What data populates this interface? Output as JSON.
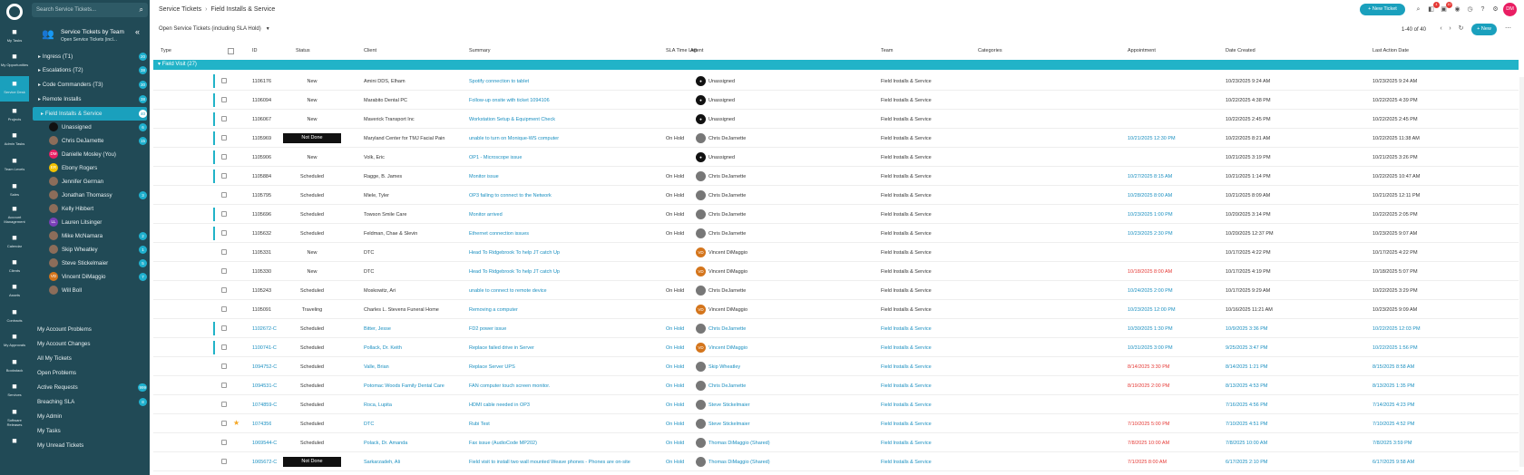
{
  "search": {
    "placeholder": "Search Service Tickets..."
  },
  "rail": [
    {
      "label": "My Tasks",
      "icon": "pencil-icon"
    },
    {
      "label": "My Opportunities",
      "icon": "dollar-icon"
    },
    {
      "label": "Service Desk",
      "icon": "service-desk-icon"
    },
    {
      "label": "Projects",
      "icon": "projects-icon"
    },
    {
      "label": "Admin Tasks",
      "icon": "checkbox-icon"
    },
    {
      "label": "Team Levels",
      "icon": "star-icon"
    },
    {
      "label": "Sales",
      "icon": "chart-icon"
    },
    {
      "label": "Account Management",
      "icon": "people-icon"
    },
    {
      "label": "Calendar",
      "icon": "calendar-icon"
    },
    {
      "label": "Clients",
      "icon": "person-icon"
    },
    {
      "label": "Assets",
      "icon": "asset-icon"
    },
    {
      "label": "Contracts",
      "icon": "contract-icon"
    },
    {
      "label": "My Approvals",
      "icon": "thumb-icon"
    },
    {
      "label": "Bookstack",
      "icon": "book-icon"
    },
    {
      "label": "Services",
      "icon": "services-icon"
    },
    {
      "label": "Software Releases",
      "icon": "release-icon"
    },
    {
      "label": "",
      "icon": "book-icon"
    }
  ],
  "panel": {
    "title": "Service Tickets by Team",
    "subtitle": "Open Service Tickets (incl...",
    "groups": [
      {
        "label": "Ingress (T1)",
        "count": "20"
      },
      {
        "label": "Escalations (T2)",
        "count": "38"
      },
      {
        "label": "Code Commanders (T3)",
        "count": "30"
      },
      {
        "label": "Remote Installs",
        "count": "38"
      },
      {
        "label": "Field Installs & Service",
        "count": "40"
      }
    ],
    "people": [
      {
        "label": "Unassigned",
        "count": "6",
        "av": ""
      },
      {
        "label": "Chris DeJarnette",
        "count": "15",
        "av": ""
      },
      {
        "label": "Danielle Mosley (You)",
        "count": "",
        "av": "DM"
      },
      {
        "label": "Ebony Rogers",
        "count": "",
        "av": "ER"
      },
      {
        "label": "Jennifer German",
        "count": "",
        "av": ""
      },
      {
        "label": "Jonathan Thomassy",
        "count": "3",
        "av": ""
      },
      {
        "label": "Kelly Hibbert",
        "count": "",
        "av": ""
      },
      {
        "label": "Lauren Litsinger",
        "count": "",
        "av": "LL"
      },
      {
        "label": "Mike McNamara",
        "count": "2",
        "av": ""
      },
      {
        "label": "Skip Wheatley",
        "count": "1",
        "av": ""
      },
      {
        "label": "Steve Stickelmaier",
        "count": "5",
        "av": ""
      },
      {
        "label": "Vincent DiMaggio",
        "count": "7",
        "av": "VD"
      },
      {
        "label": "Will Boll",
        "count": "",
        "av": ""
      }
    ],
    "links": [
      {
        "label": "My Account Problems",
        "count": ""
      },
      {
        "label": "My Account Changes",
        "count": ""
      },
      {
        "label": "All My Tickets",
        "count": ""
      },
      {
        "label": "Open Problems",
        "count": ""
      },
      {
        "label": "Active Requests",
        "count": "999"
      },
      {
        "label": "Breaching SLA",
        "count": "8"
      },
      {
        "label": "My Admin",
        "count": ""
      },
      {
        "label": "My Tasks",
        "count": ""
      },
      {
        "label": "My Unread Tickets",
        "count": ""
      }
    ]
  },
  "header": {
    "crumb1": "Service Tickets",
    "crumb2": "Field Installs & Service",
    "new_ticket": "+ New Ticket",
    "new_btn": "+ New",
    "badge1": "4",
    "badge2": "10",
    "user": "DM"
  },
  "view": {
    "label": "Open Service Tickets (including SLA Hold)",
    "pageinfo": "1-40 of 40"
  },
  "columns": [
    "Type",
    "ID",
    "Status",
    "Client",
    "Summary",
    "SLA Time Left",
    "Agent",
    "Team",
    "Categories",
    "Appointment",
    "Date Created",
    "Last Action Date"
  ],
  "group": "Field Visit (27)",
  "rows": [
    {
      "id": "1106176",
      "status": "New",
      "client": "Amini DDS, Elham",
      "summary": "Spotify connection to tablet",
      "sla": "",
      "agent": "Unassigned",
      "av": "un",
      "team": "Field Installs & Service",
      "appt": "",
      "created": "10/23/2025 9:24 AM",
      "last": "10/23/2025 9:24 AM",
      "bar": true,
      "link": false,
      "nd": false,
      "star": false
    },
    {
      "id": "1106094",
      "status": "New",
      "client": "Marabito Dental PC",
      "summary": "Follow-up onsite with ticket 1094106",
      "sla": "",
      "agent": "Unassigned",
      "av": "un",
      "team": "Field Installs & Service",
      "appt": "",
      "created": "10/22/2025 4:38 PM",
      "last": "10/22/2025 4:39 PM",
      "bar": true,
      "link": false,
      "nd": false,
      "star": false
    },
    {
      "id": "1106067",
      "status": "New",
      "client": "Maverick Transport Inc",
      "summary": "Workstation Setup & Equipment Check",
      "sla": "",
      "agent": "Unassigned",
      "av": "un",
      "team": "Field Installs & Service",
      "appt": "",
      "created": "10/22/2025 2:45 PM",
      "last": "10/22/2025 2:45 PM",
      "bar": true,
      "link": false,
      "nd": false,
      "star": false
    },
    {
      "id": "1105969",
      "status": "Not Done",
      "client": "Maryland Center for TMJ Facial Pain",
      "summary": "unable to turn on Monique-WS computer",
      "sla": "On Hold",
      "agent": "Chris DeJarnette",
      "av": "",
      "team": "Field Installs & Service",
      "appt": "10/21/2025 12:30 PM",
      "created": "10/22/2025 8:21 AM",
      "last": "10/22/2025 11:38 AM",
      "bar": true,
      "link": false,
      "nd": true,
      "star": false
    },
    {
      "id": "1105906",
      "status": "New",
      "client": "Volk, Eric",
      "summary": "OP1 - Microscope issue",
      "sla": "",
      "agent": "Unassigned",
      "av": "un",
      "team": "Field Installs & Service",
      "appt": "",
      "created": "10/21/2025 3:19 PM",
      "last": "10/21/2025 3:26 PM",
      "bar": true,
      "link": false,
      "nd": false,
      "star": false
    },
    {
      "id": "1105884",
      "status": "Scheduled",
      "client": "Ragge, B. James",
      "summary": "Monitor issue",
      "sla": "On Hold",
      "agent": "Chris DeJarnette",
      "av": "",
      "team": "Field Installs & Service",
      "appt": "10/27/2025 8:15 AM",
      "created": "10/21/2025 1:14 PM",
      "last": "10/22/2025 10:47 AM",
      "bar": true,
      "link": false,
      "nd": false,
      "star": false
    },
    {
      "id": "1105795",
      "status": "Scheduled",
      "client": "Miele, Tyler",
      "summary": "OP3 failing to connect to the Network",
      "sla": "On Hold",
      "agent": "Chris DeJarnette",
      "av": "",
      "team": "Field Installs & Service",
      "appt": "10/28/2025 8:00 AM",
      "created": "10/21/2025 8:09 AM",
      "last": "10/21/2025 12:11 PM",
      "bar": false,
      "link": false,
      "nd": false,
      "star": false
    },
    {
      "id": "1105696",
      "status": "Scheduled",
      "client": "Towson Smile Care",
      "summary": "Monitor arrived",
      "sla": "On Hold",
      "agent": "Chris DeJarnette",
      "av": "",
      "team": "Field Installs & Service",
      "appt": "10/23/2025 1:00 PM",
      "created": "10/20/2025 3:14 PM",
      "last": "10/22/2025 2:05 PM",
      "bar": true,
      "link": false,
      "nd": false,
      "star": false
    },
    {
      "id": "1105632",
      "status": "Scheduled",
      "client": "Feldman, Chae & Slevin",
      "summary": "Ethernet connection issues",
      "sla": "On Hold",
      "agent": "Chris DeJarnette",
      "av": "",
      "team": "Field Installs & Service",
      "appt": "10/23/2025 2:30 PM",
      "created": "10/20/2025 12:37 PM",
      "last": "10/23/2025 9:07 AM",
      "bar": true,
      "link": false,
      "nd": false,
      "star": false
    },
    {
      "id": "1105331",
      "status": "New",
      "client": "DTC",
      "summary": "Head To Ridgebrook To help JT catch Up",
      "sla": "",
      "agent": "Vincent DiMaggio",
      "av": "vd",
      "team": "Field Installs & Service",
      "appt": "",
      "created": "10/17/2025 4:22 PM",
      "last": "10/17/2025 4:22 PM",
      "bar": false,
      "link": false,
      "nd": false,
      "star": false
    },
    {
      "id": "1105330",
      "status": "New",
      "client": "DTC",
      "summary": "Head To Ridgebrook To help JT catch Up",
      "sla": "",
      "agent": "Vincent DiMaggio",
      "av": "vd",
      "team": "Field Installs & Service",
      "appt": "10/18/2025 8:00 AM",
      "apptred": true,
      "created": "10/17/2025 4:19 PM",
      "last": "10/18/2025 5:07 PM",
      "bar": false,
      "link": false,
      "nd": false,
      "star": false
    },
    {
      "id": "1105243",
      "status": "Scheduled",
      "client": "Moskowitz, Ari",
      "summary": "unable to connect to remote device",
      "sla": "On Hold",
      "agent": "Chris DeJarnette",
      "av": "",
      "team": "Field Installs & Service",
      "appt": "10/24/2025 2:00 PM",
      "created": "10/17/2025 9:29 AM",
      "last": "10/22/2025 3:29 PM",
      "bar": false,
      "link": false,
      "nd": false,
      "star": false
    },
    {
      "id": "1105091",
      "status": "Traveling",
      "client": "Charles L. Stevens Funeral Home",
      "summary": "Removing a computer",
      "sla": "",
      "agent": "Vincent DiMaggio",
      "av": "vd",
      "team": "Field Installs & Service",
      "appt": "10/23/2025 12:00 PM",
      "created": "10/16/2025 11:21 AM",
      "last": "10/23/2025 9:09 AM",
      "bar": false,
      "link": false,
      "nd": false,
      "star": false
    },
    {
      "id": "1102672-C",
      "status": "Scheduled",
      "client": "Bitter, Jesse",
      "summary": "FD2 power issue",
      "sla": "On Hold",
      "agent": "Chris DeJarnette",
      "av": "",
      "team": "Field Installs & Service",
      "appt": "10/30/2025 1:30 PM",
      "created": "10/9/2025 3:36 PM",
      "last": "10/22/2025 12:03 PM",
      "bar": true,
      "link": true,
      "nd": false,
      "star": false
    },
    {
      "id": "1100741-C",
      "status": "Scheduled",
      "client": "Pollack, Dr. Keith",
      "summary": "Replace failed drive in Server",
      "sla": "On Hold",
      "agent": "Vincent DiMaggio",
      "av": "vd",
      "team": "Field Installs & Service",
      "appt": "10/31/2025 3:00 PM",
      "created": "9/25/2025 3:47 PM",
      "last": "10/22/2025 1:56 PM",
      "bar": true,
      "link": true,
      "nd": false,
      "star": false
    },
    {
      "id": "1094752-C",
      "status": "Scheduled",
      "client": "Valle, Brian",
      "summary": "Replace Server UPS",
      "sla": "On Hold",
      "agent": "Skip Wheatley",
      "av": "",
      "team": "Field Installs & Service",
      "appt": "8/14/2025 3:30 PM",
      "apptred": true,
      "created": "8/14/2025 1:21 PM",
      "last": "8/15/2025 8:58 AM",
      "bar": false,
      "link": true,
      "nd": false,
      "star": false
    },
    {
      "id": "1094531-C",
      "status": "Scheduled",
      "client": "Potomac Woods Family Dental Care",
      "summary": "FAN computer touch screen monitor.",
      "sla": "On Hold",
      "agent": "Chris DeJarnette",
      "av": "",
      "team": "Field Installs & Service",
      "appt": "8/19/2025 2:00 PM",
      "apptred": true,
      "created": "8/13/2025 4:53 PM",
      "last": "8/13/2025 1:35 PM",
      "bar": false,
      "link": true,
      "nd": false,
      "star": false
    },
    {
      "id": "1074859-C",
      "status": "Scheduled",
      "client": "Roca, Lupita",
      "summary": "HDMI cable needed in OP3",
      "sla": "On Hold",
      "agent": "Steve Stickelmaier",
      "av": "",
      "team": "Field Installs & Service",
      "appt": "",
      "created": "7/16/2025 4:56 PM",
      "last": "7/14/2025 4:23 PM",
      "bar": false,
      "link": true,
      "nd": false,
      "star": false
    },
    {
      "id": "1074356",
      "status": "Scheduled",
      "client": "DTC",
      "summary": "Rubi Test",
      "sla": "On Hold",
      "agent": "Steve Stickelmaier",
      "av": "",
      "team": "Field Installs & Service",
      "appt": "7/10/2025 5:00 PM",
      "apptred": true,
      "created": "7/10/2025 4:51 PM",
      "last": "7/10/2025 4:52 PM",
      "bar": false,
      "link": true,
      "nd": false,
      "star": true
    },
    {
      "id": "1069544-C",
      "status": "Scheduled",
      "client": "Polack, Dr. Amanda",
      "summary": "Fax issue (AudioCode MP202)",
      "sla": "On Hold",
      "agent": "Thomas DiMaggio (Shared)",
      "av": "",
      "team": "Field Installs & Service",
      "appt": "7/8/2025 10:00 AM",
      "apptred": true,
      "created": "7/8/2025 10:00 AM",
      "last": "7/8/2025 3:59 PM",
      "bar": false,
      "link": true,
      "nd": false,
      "star": false
    },
    {
      "id": "1065672-C",
      "status": "Not Done",
      "client": "Sarkarzadeh, Ali",
      "summary": "Field visit to install two wall mounted Weave phones - Phones are on-site",
      "sla": "On Hold",
      "agent": "Thomas DiMaggio (Shared)",
      "av": "",
      "team": "Field Installs & Service",
      "appt": "7/1/2025 8:00 AM",
      "apptred": true,
      "created": "6/17/2025 2:10 PM",
      "last": "6/17/2025 9:58 AM",
      "bar": false,
      "link": true,
      "nd": true,
      "star": false
    }
  ]
}
